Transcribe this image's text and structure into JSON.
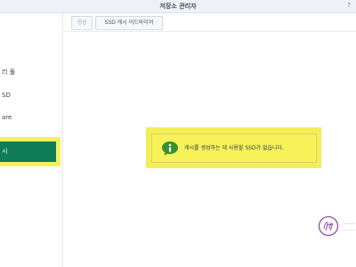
{
  "window": {
    "title": "저장소 관리자",
    "help_icon": "help-icon"
  },
  "sidebar": {
    "items": [
      {
        "label": "리 풀"
      },
      {
        "label": "SD"
      },
      {
        "label": "are"
      },
      {
        "label": "시",
        "active": true
      }
    ]
  },
  "toolbar": {
    "create_label": "생성",
    "advisor_label": "SSD 캐시 어드바이저"
  },
  "notice": {
    "icon": "info-icon",
    "message": "캐시를 생성하는 데 사용할 SSD가 없습니다."
  },
  "colors": {
    "accent_green": "#0f7d57",
    "highlight_yellow": "#f4ee55",
    "info_green": "#3c8f2f"
  }
}
